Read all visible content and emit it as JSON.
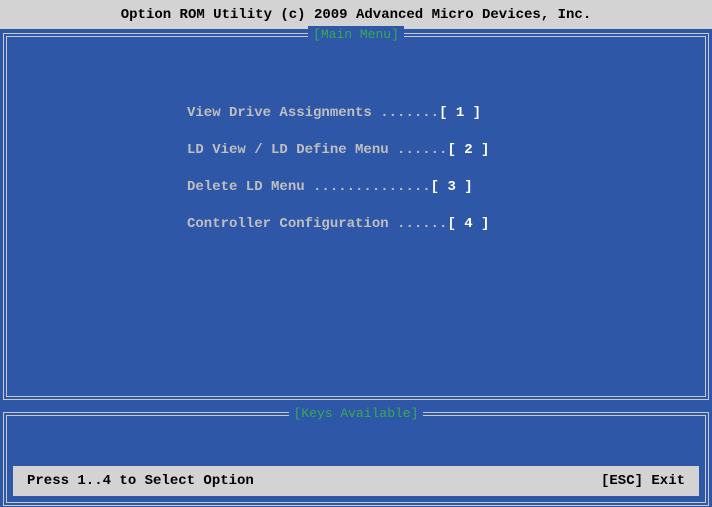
{
  "title": "Option ROM Utility (c) 2009 Advanced Micro Devices, Inc.",
  "main_panel": {
    "title": "[Main Menu]",
    "items": [
      {
        "label": "View Drive Assignments",
        "dots": " .......",
        "key": "[ 1 ]"
      },
      {
        "label": "LD View / LD Define Menu",
        "dots": " ......",
        "key": "[ 2 ]"
      },
      {
        "label": "Delete LD Menu",
        "dots": " ..............",
        "key": "[ 3 ]"
      },
      {
        "label": "Controller Configuration",
        "dots": " ......",
        "key": "[ 4 ]"
      }
    ]
  },
  "keys_panel": {
    "title": "[Keys Available]",
    "hint": "Press 1..4 to Select Option",
    "exit": "[ESC] Exit"
  },
  "colors": {
    "background": "#2e57a8",
    "title_bar": "#d3d3d3",
    "panel_title": "#3aa852",
    "menu_text": "#bfbfbf",
    "key_text": "#ffffff"
  }
}
